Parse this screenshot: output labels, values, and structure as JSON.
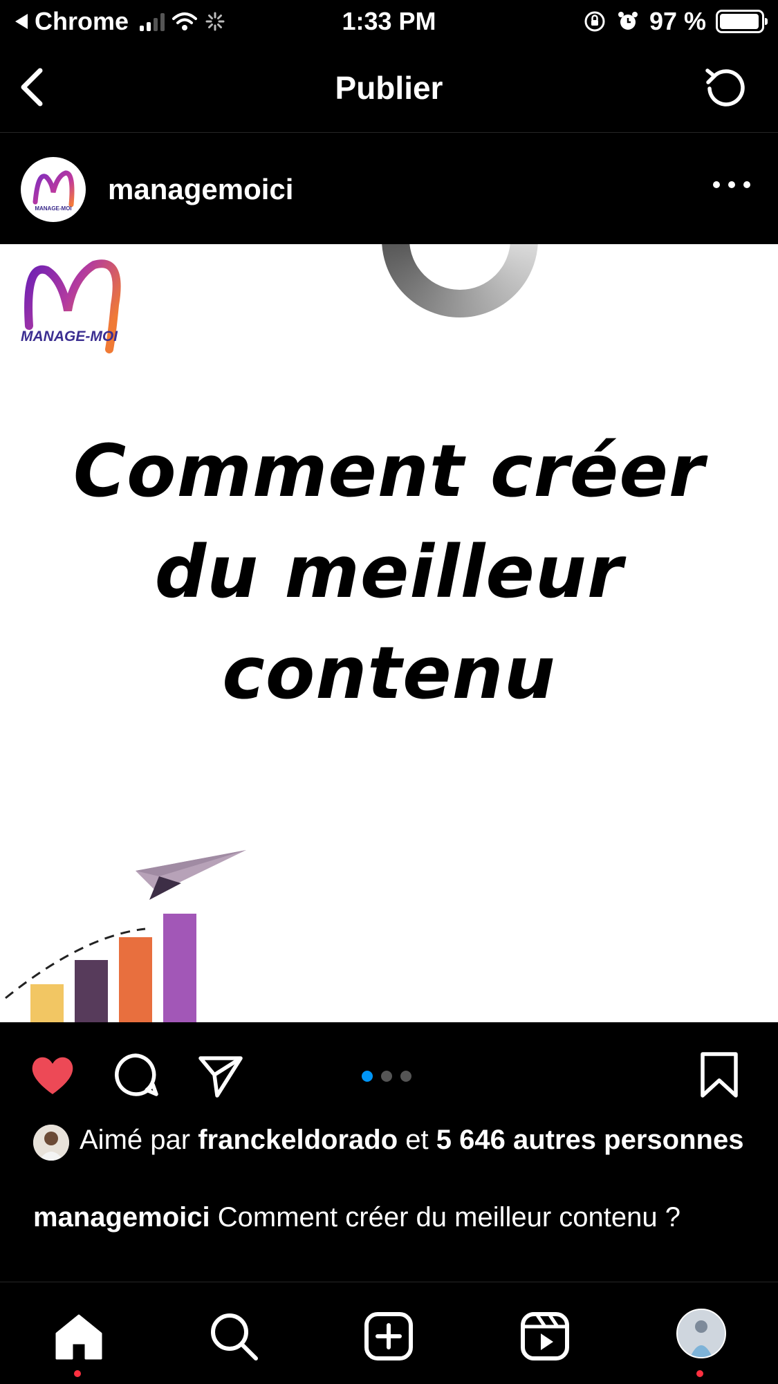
{
  "status_bar": {
    "back_app": "Chrome",
    "time": "1:33 PM",
    "battery_percent": "97 %",
    "battery_level": 0.97
  },
  "header": {
    "title": "Publier"
  },
  "post": {
    "author": "managemoici",
    "image": {
      "logo_text": "MANAGE-MOI",
      "headline_lines": [
        "Comment créer",
        "du meilleur",
        "contenu"
      ]
    },
    "carousel": {
      "count": 3,
      "active_index": 0
    },
    "likes": {
      "prefix": "Aimé par",
      "liked_by": "franckeldorado",
      "connector": "et",
      "others": "5 646 autres personnes"
    },
    "caption": {
      "author": "managemoici",
      "text": "Comment créer du meilleur contenu ?"
    }
  },
  "colors": {
    "like_red": "#ed4956",
    "accent_blue": "#0095f6",
    "background": "#000000"
  },
  "bottom_nav": {
    "items": [
      "home-icon",
      "search-icon",
      "create-icon",
      "reels-icon",
      "profile-avatar"
    ]
  }
}
